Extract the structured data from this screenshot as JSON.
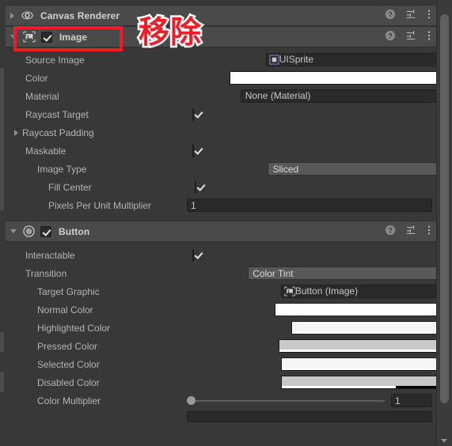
{
  "window": {
    "background": "#383838",
    "scrollbar": {
      "name": "vertical-scrollbar",
      "thumb_top_pct": 3,
      "thumb_height_pct": 87
    }
  },
  "annotation": {
    "text": "移除",
    "color": "#f01c26",
    "outline_color": "#ffffff",
    "box_color": "#ee1c25",
    "target": "Image component header"
  },
  "components": [
    {
      "id": "canvas-renderer",
      "title": "Canvas Renderer",
      "expanded": false,
      "icon": "eye-icon",
      "has_checkbox": false,
      "header_icons": [
        "help-icon",
        "preset-icon",
        "menu-icon"
      ]
    },
    {
      "id": "image",
      "title": "Image",
      "expanded": true,
      "icon": "image-component-icon",
      "has_checkbox": true,
      "checked": true,
      "header_icons": [
        "help-icon",
        "preset-icon",
        "menu-icon"
      ]
    },
    {
      "id": "button",
      "title": "Button",
      "expanded": true,
      "icon": "button-component-icon",
      "has_checkbox": true,
      "checked": true,
      "header_icons": [
        "help-icon",
        "preset-icon",
        "menu-icon"
      ]
    }
  ],
  "image_properties": {
    "source_image": {
      "label": "Source Image",
      "value": "UISprite",
      "icon": "sprite-icon",
      "type": "object"
    },
    "color": {
      "label": "Color",
      "value": "#FFFFFF",
      "alpha_pct": 100,
      "type": "color"
    },
    "material": {
      "label": "Material",
      "value": "None (Material)",
      "type": "object"
    },
    "raycast_target": {
      "label": "Raycast Target",
      "checked": true,
      "type": "bool"
    },
    "raycast_padding": {
      "label": "Raycast Padding",
      "expanded": false,
      "type": "foldout"
    },
    "maskable": {
      "label": "Maskable",
      "checked": true,
      "type": "bool"
    },
    "image_type": {
      "label": "Image Type",
      "value": "Sliced",
      "type": "enum"
    },
    "fill_center": {
      "label": "Fill Center",
      "checked": true,
      "type": "bool"
    },
    "pixels_per_unit_multiplier": {
      "label": "Pixels Per Unit Multiplier",
      "value": "1",
      "type": "number"
    }
  },
  "button_properties": {
    "interactable": {
      "label": "Interactable",
      "checked": true,
      "type": "bool"
    },
    "transition": {
      "label": "Transition",
      "value": "Color Tint",
      "type": "enum"
    },
    "target_graphic": {
      "label": "Target Graphic",
      "value": "Button (Image)",
      "icon": "image-component-icon",
      "type": "object"
    },
    "normal_color": {
      "label": "Normal Color",
      "value": "#FFFFFF",
      "alpha_pct": 100,
      "type": "color"
    },
    "highlighted_color": {
      "label": "Highlighted Color",
      "value": "#F5F5F5",
      "alpha_pct": 100,
      "type": "color"
    },
    "pressed_color": {
      "label": "Pressed Color",
      "value": "#C8C8C8",
      "alpha_pct": 100,
      "type": "color"
    },
    "selected_color": {
      "label": "Selected Color",
      "value": "#F5F5F5",
      "alpha_pct": 100,
      "type": "color"
    },
    "disabled_color": {
      "label": "Disabled Color",
      "value": "#C8C8C8",
      "alpha_pct": 50,
      "type": "color"
    },
    "color_multiplier": {
      "label": "Color Multiplier",
      "value": "1",
      "slider_pct": 0,
      "type": "slider"
    }
  }
}
